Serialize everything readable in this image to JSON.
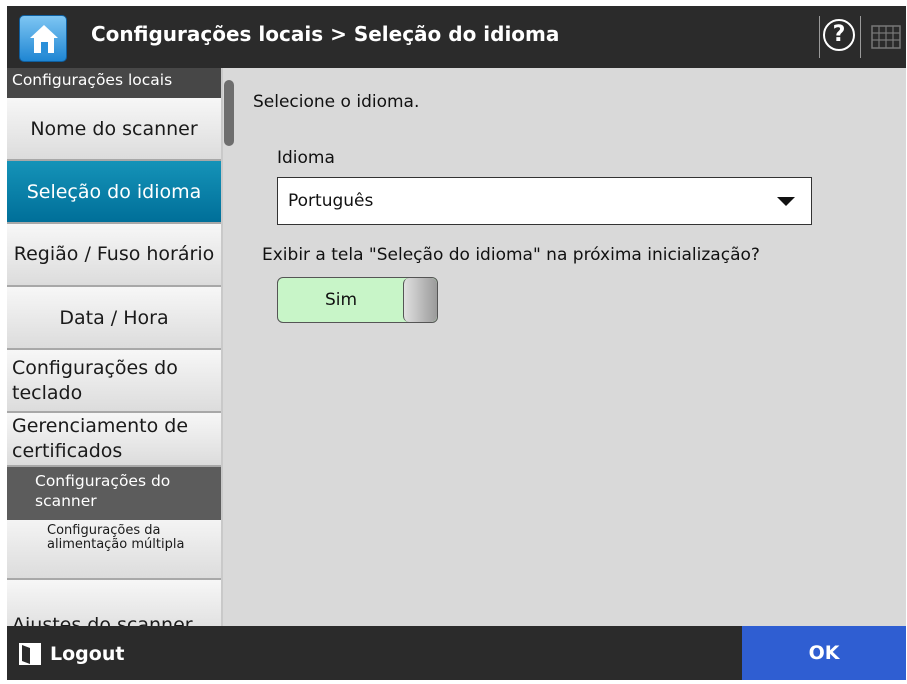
{
  "header": {
    "title": "Configurações locais > Seleção do idioma",
    "home_icon": "home-icon",
    "help_icon": "help-icon",
    "keyboard_icon": "keyboard-icon",
    "help_glyph": "?"
  },
  "sidebar": {
    "section_header": "Configurações locais",
    "items": [
      {
        "label": "Nome do scanner"
      },
      {
        "label": "Seleção do idioma",
        "active": true
      },
      {
        "label": "Região / Fuso horário"
      },
      {
        "label": "Data / Hora"
      },
      {
        "label": "Configurações do teclado"
      },
      {
        "label": "Gerenciamento de certificados"
      }
    ],
    "sub_header": "Configurações do scanner",
    "sub_items": [
      {
        "label": "Configurações da alimentação múltipla"
      }
    ],
    "last_item": "Ajustes do scanner"
  },
  "content": {
    "prompt": "Selecione o idioma.",
    "language_label": "Idioma",
    "language_value": "Português",
    "question": "Exibir a tela \"Seleção do idioma\" na próxima inicialização?",
    "toggle_label": "Sim",
    "toggle_on": true
  },
  "footer": {
    "logout_label": "Logout",
    "ok_label": "OK"
  },
  "colors": {
    "header_bg": "#2b2b2b",
    "active_item": "#007fa8",
    "toggle_on": "#c8f5c8",
    "ok_button": "#2f5ed2"
  }
}
